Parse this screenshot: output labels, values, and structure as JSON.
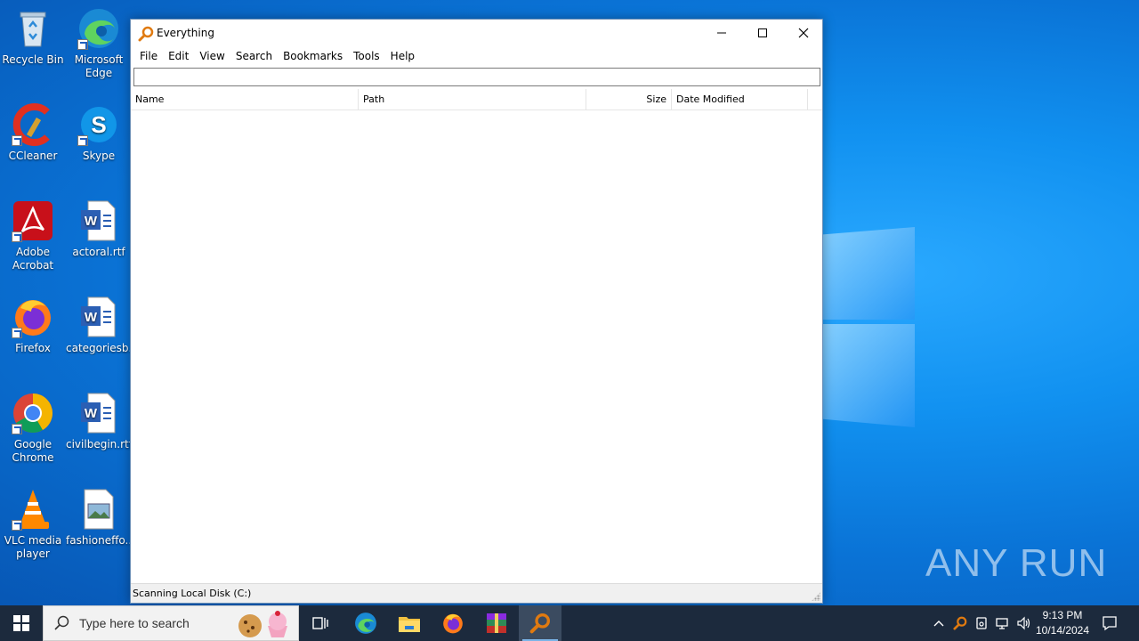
{
  "desktop": {
    "icons": [
      {
        "label": "Recycle Bin"
      },
      {
        "label": "Microsoft Edge"
      },
      {
        "label": "CCleaner"
      },
      {
        "label": "Skype"
      },
      {
        "label": "Adobe Acrobat"
      },
      {
        "label": "actoral.rtf"
      },
      {
        "label": "Firefox"
      },
      {
        "label": "categoriesb..."
      },
      {
        "label": "Google Chrome"
      },
      {
        "label": "civilbegin.rtf"
      },
      {
        "label": "VLC media player"
      },
      {
        "label": "fashioneffo..."
      }
    ]
  },
  "window": {
    "title": "Everything",
    "menu": [
      "File",
      "Edit",
      "View",
      "Search",
      "Bookmarks",
      "Tools",
      "Help"
    ],
    "search": {
      "value": "",
      "placeholder": ""
    },
    "columns": [
      "Name",
      "Path",
      "Size",
      "Date Modified"
    ],
    "status": "Scanning Local Disk (C:)"
  },
  "watermark": "ANY RUN",
  "taskbar": {
    "search_placeholder": "Type here to search",
    "clock": {
      "time": "9:13 PM",
      "date": "10/14/2024"
    }
  },
  "colors": {
    "desktop": "#0a73d6",
    "taskbar": "#1c2a3d",
    "everything_icon": "#e07a10"
  }
}
